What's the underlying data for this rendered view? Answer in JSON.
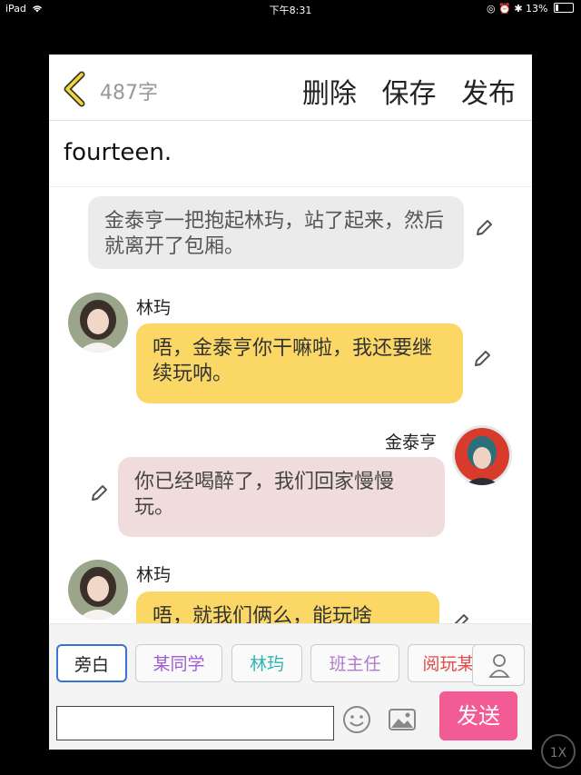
{
  "status_bar": {
    "device": "iPad",
    "time": "下午8:31",
    "battery": "13%"
  },
  "header": {
    "word_count": "487字",
    "delete_label": "删除",
    "save_label": "保存",
    "publish_label": "发布"
  },
  "chapter_title": "fourteen.",
  "messages": [
    {
      "type": "narration",
      "text": "金泰亨一把抱起林玙，站了起来，然后就离开了包厢。"
    },
    {
      "speaker": "林玙",
      "text": "唔，金泰亨你干嘛啦，我还要继续玩呐。"
    },
    {
      "speaker": "金泰亨",
      "text": "你已经喝醉了，我们回家慢慢玩。"
    },
    {
      "speaker": "林玙",
      "text": "唔，就我们俩么，能玩啥"
    }
  ],
  "characters": [
    {
      "label": "旁白",
      "color": "#222222",
      "selected": true
    },
    {
      "label": "某同学",
      "color": "#a05ad0"
    },
    {
      "label": "林玙",
      "color": "#2bb7b0"
    },
    {
      "label": "班主任",
      "color": "#b07ad0"
    },
    {
      "label": "阅玩某",
      "color": "#e04a4a"
    }
  ],
  "composer": {
    "input_value": "",
    "send_label": "发送"
  },
  "zoom_button": "1X"
}
